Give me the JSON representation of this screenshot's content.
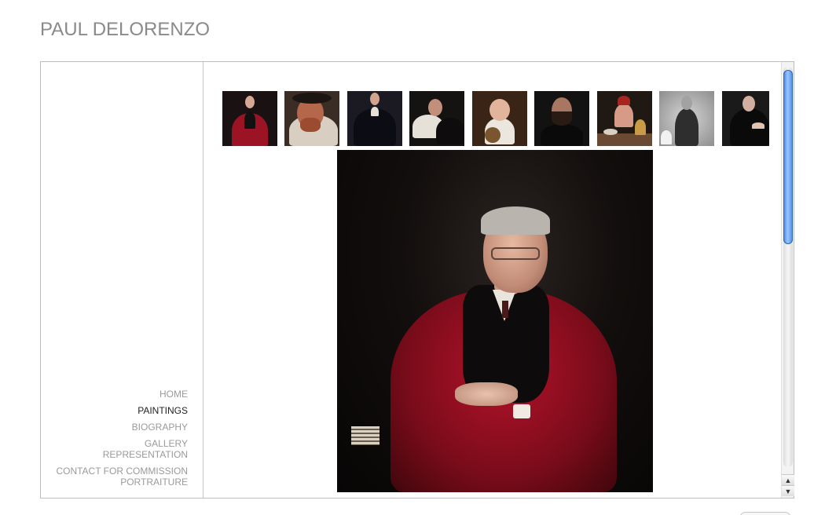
{
  "site": {
    "title": "PAUL DELORENZO"
  },
  "nav": {
    "items": [
      {
        "label": "HOME",
        "active": false
      },
      {
        "label": "PAINTINGS",
        "active": true
      },
      {
        "label": "BIOGRAPHY",
        "active": false
      },
      {
        "label": "GALLERY\nREPRESENTATION",
        "active": false
      },
      {
        "label": "CONTACT FOR COMMISSION\nPORTRAITURE",
        "active": false
      }
    ]
  },
  "gallery": {
    "thumbnails": [
      {
        "name": "portrait-red-robe"
      },
      {
        "name": "portrait-bearded-hat"
      },
      {
        "name": "portrait-dark-robe"
      },
      {
        "name": "portrait-reclining-man"
      },
      {
        "name": "portrait-child-with-bear"
      },
      {
        "name": "portrait-young-bearded-man"
      },
      {
        "name": "still-life-tabletop"
      },
      {
        "name": "portrait-standing-suit"
      },
      {
        "name": "portrait-seated-judge"
      },
      {
        "name": "portrait-partial"
      }
    ],
    "selected_index": 0
  },
  "colors": {
    "title": "#8a8a8a",
    "nav_inactive": "#9a9a9a",
    "nav_active": "#222222",
    "frame_border": "#bdbdbd",
    "scroll_thumb": "#4a8ae8"
  },
  "scrollbar": {
    "up_glyph": "▲",
    "down_glyph": "▼"
  }
}
